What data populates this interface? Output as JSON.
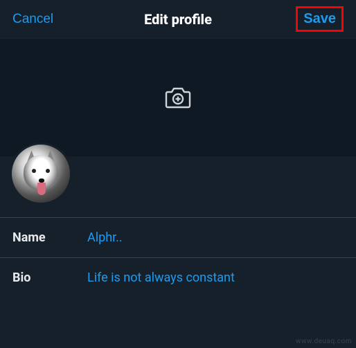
{
  "header": {
    "cancel_label": "Cancel",
    "title": "Edit profile",
    "save_label": "Save"
  },
  "banner": {
    "camera_icon": "camera-plus"
  },
  "avatar": {
    "description": "husky-dog-photo"
  },
  "fields": {
    "name": {
      "label": "Name",
      "value": "Alphr.."
    },
    "bio": {
      "label": "Bio",
      "value": "Life is not always constant"
    }
  },
  "watermark": "www.deuaq.com"
}
